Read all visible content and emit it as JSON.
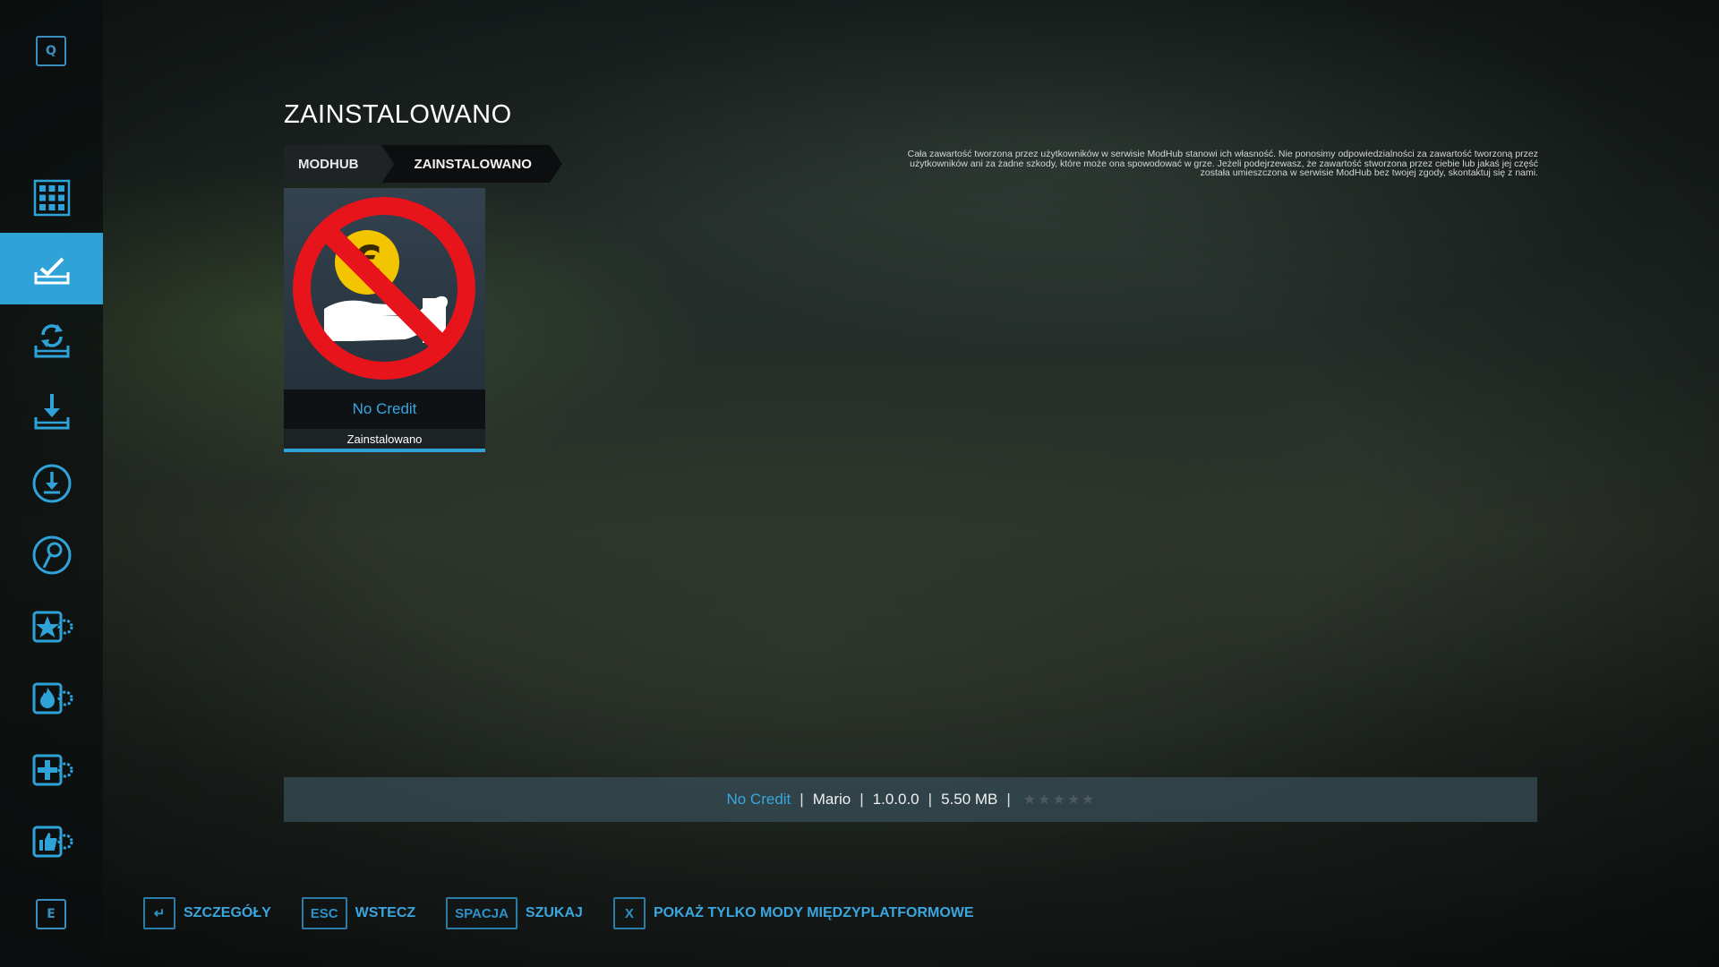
{
  "sidebar": {
    "top_key": "Q",
    "bottom_key": "E",
    "items": [
      {
        "icon": "grid-icon",
        "active": false
      },
      {
        "icon": "installed-mods-icon",
        "active": true
      },
      {
        "icon": "update-mods-icon",
        "active": false
      },
      {
        "icon": "download-tray-icon",
        "active": false
      },
      {
        "icon": "download-circle-icon",
        "active": false
      },
      {
        "icon": "map-pin-icon",
        "active": false
      },
      {
        "icon": "star-gear-icon",
        "active": false
      },
      {
        "icon": "fire-gear-icon",
        "active": false
      },
      {
        "icon": "plus-gear-icon",
        "active": false
      },
      {
        "icon": "thumb-gear-icon",
        "active": false
      }
    ]
  },
  "page_title": "ZAINSTALOWANO",
  "breadcrumb": {
    "root": "MODHUB",
    "current": "ZAINSTALOWANO"
  },
  "disclaimer": {
    "line1": "Cała zawartość tworzona przez użytkowników w serwisie ModHub stanowi ich własność. Nie ponosimy odpowiedzialności za zawartość tworzoną przez",
    "line2": "użytkowników ani za żadne szkody, które może ona spowodować w grze. Jeżeli podejrzewasz, że zawartość stworzona przez ciebie lub jakaś jej część",
    "line3": "została umieszczona w serwisie ModHub bez twojej zgody, skontaktuj się z nami."
  },
  "mod_card": {
    "name": "No Credit",
    "status": "Zainstalowano",
    "image_icon": "no-credit-euro-icon"
  },
  "info_bar": {
    "name": "No Credit",
    "author": "Mario",
    "version": "1.0.0.0",
    "size": "5.50 MB",
    "rating": 0,
    "rating_max": 5,
    "separator": "|"
  },
  "actions": [
    {
      "key": "↵",
      "label": "SZCZEGÓŁY"
    },
    {
      "key": "ESC",
      "label": "WSTECZ"
    },
    {
      "key": "SPACJA",
      "label": "SZUKAJ"
    },
    {
      "key": "X",
      "label": "POKAŻ TYLKO MODY MIĘDZYPLATFORMOWE"
    }
  ],
  "colors": {
    "accent": "#2fa3d8",
    "accent_text": "#3aa6df",
    "sidebar_bg": "#0a0e0e"
  }
}
